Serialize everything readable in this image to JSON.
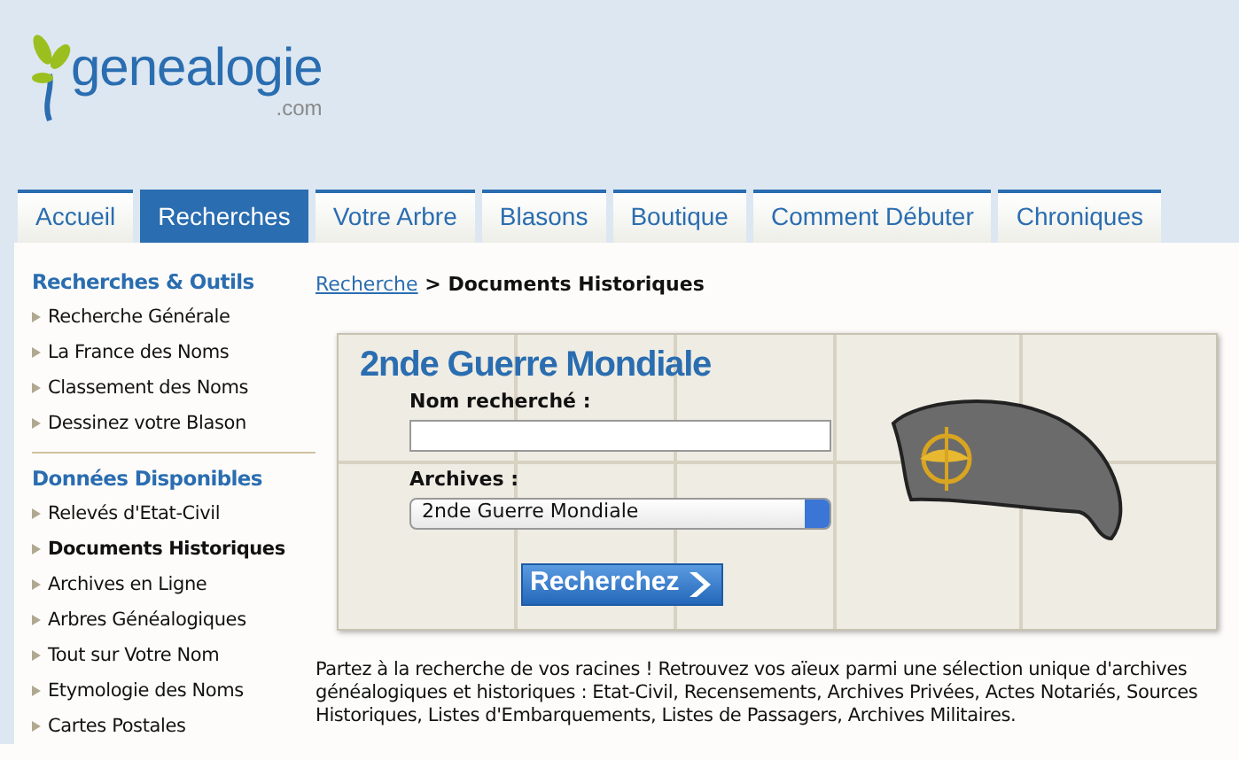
{
  "logo": {
    "name": "genealogie",
    "suffix": ".com"
  },
  "tabs": [
    {
      "label": "Accueil",
      "selected": false
    },
    {
      "label": "Recherches",
      "selected": true
    },
    {
      "label": "Votre Arbre",
      "selected": false
    },
    {
      "label": "Blasons",
      "selected": false
    },
    {
      "label": "Boutique",
      "selected": false
    },
    {
      "label": "Comment Débuter",
      "selected": false
    },
    {
      "label": "Chroniques",
      "selected": false
    }
  ],
  "sidebar": {
    "sections": [
      {
        "title": "Recherches & Outils",
        "items": [
          {
            "label": "Recherche Générale",
            "selected": false
          },
          {
            "label": "La France des Noms",
            "selected": false
          },
          {
            "label": "Classement des Noms",
            "selected": false
          },
          {
            "label": "Dessinez votre Blason",
            "selected": false
          }
        ]
      },
      {
        "title": "Données Disponibles",
        "items": [
          {
            "label": "Relevés d'Etat-Civil",
            "selected": false
          },
          {
            "label": "Documents Historiques",
            "selected": true
          },
          {
            "label": "Archives en Ligne",
            "selected": false
          },
          {
            "label": "Arbres Généalogiques",
            "selected": false
          },
          {
            "label": "Tout sur Votre Nom",
            "selected": false
          },
          {
            "label": "Etymologie des Noms",
            "selected": false
          },
          {
            "label": "Cartes Postales",
            "selected": false
          }
        ]
      }
    ]
  },
  "breadcrumb": {
    "link": "Recherche",
    "separator": ">",
    "current": "Documents Historiques"
  },
  "search_form": {
    "title": "2nde Guerre Mondiale",
    "name_label": "Nom recherché :",
    "archives_label": "Archives :",
    "archives_value": "2nde Guerre Mondiale",
    "submit": "Recherchez"
  },
  "description": "Partez à la recherche de vos racines ! Retrouvez vos aïeux parmi une sélection unique d'archives généalogiques et historiques : Etat-Civil, Recensements, Archives Privées, Actes Notariés, Sources Historiques, Listes d'Embarquements, Listes de Passagers, Archives Militaires."
}
